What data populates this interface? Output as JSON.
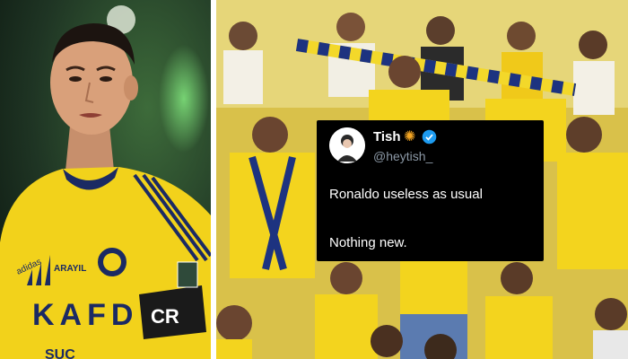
{
  "tweet": {
    "name": "Tish",
    "handle": "@heytish_",
    "name_emoji_icon": "sun-icon",
    "badge_icon": "verified-badge-icon",
    "line1": "Ronaldo useless as usual",
    "line2": "Nothing new."
  },
  "jersey": {
    "sponsor": "KAFD",
    "kit_brand": "adidas",
    "kit_brand_2": "ARAYIL",
    "armband": "CR",
    "bottom_text": "SUC"
  },
  "colors": {
    "jersey_yellow": "#f2d21b",
    "jersey_navy": "#1b2a63",
    "verified_blue": "#1d9bf0",
    "tweet_bg": "#000000"
  }
}
